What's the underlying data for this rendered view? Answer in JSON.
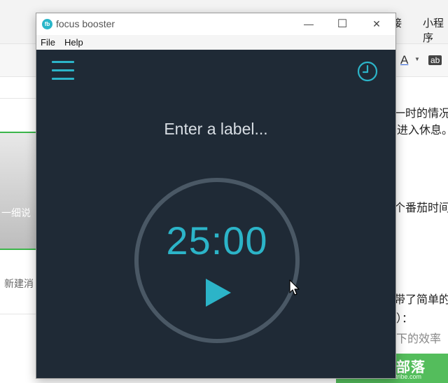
{
  "background_doc": {
    "tabs": [
      "接",
      "小程序"
    ],
    "toolbar_tools": [
      "A",
      "ab"
    ],
    "left_panel_text": "一细说",
    "left_new_message": "新建消",
    "right_snippets": [
      "一时的情况。",
      "进入休息。",
      "个番茄时间时",
      "带了简单的",
      "）：",
      "下的效率"
    ],
    "watermark_title": "笔记部落",
    "watermark_url": "www.notetribe.com"
  },
  "window": {
    "logo_text": "fb",
    "title": "focus booster",
    "minimize": "—",
    "maximize": "☐",
    "close": "✕"
  },
  "menu": {
    "items": [
      "File",
      "Help"
    ]
  },
  "app": {
    "label_placeholder": "Enter a label...",
    "timer": "25:00",
    "colors": {
      "accent": "#2cb4c8",
      "background": "#1f2a36",
      "ring": "#4a5865",
      "label_text": "#d8dee4"
    },
    "icons": {
      "menu": "hamburger-menu-icon",
      "history": "clock-history-icon",
      "play": "play-icon"
    }
  }
}
